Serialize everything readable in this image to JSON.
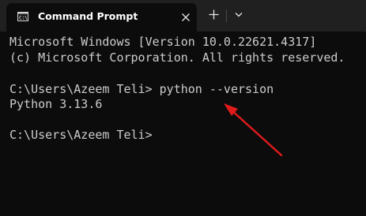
{
  "window": {
    "tab_title": "Command Prompt"
  },
  "icons": {
    "tab_icon": "cmd-icon",
    "close": "close-icon",
    "new_tab": "plus-icon",
    "dropdown": "chevron-down-icon",
    "annotation": "red-arrow-icon"
  },
  "colors": {
    "titlebar": "#202020",
    "console_bg": "#0c0c0c",
    "console_text": "#cccccc",
    "annotation_arrow": "#e11b1b"
  },
  "console": {
    "lines": [
      "Microsoft Windows [Version 10.0.22621.4317]",
      "(c) Microsoft Corporation. All rights reserved.",
      "",
      "C:\\Users\\Azeem Teli> python --version",
      "Python 3.13.6",
      "",
      "C:\\Users\\Azeem Teli>"
    ]
  }
}
